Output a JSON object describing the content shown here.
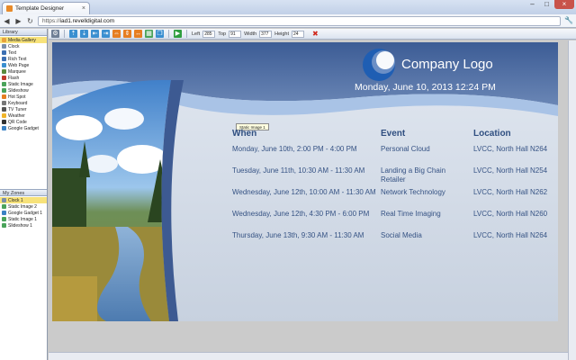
{
  "browser": {
    "tab_title": "Template Designer",
    "tab_close": "×",
    "address_scheme": "https://",
    "address_rest": "iad1.revelldigital.com",
    "window_controls": [
      "–",
      "□",
      "×"
    ],
    "nav_back": "◀",
    "nav_forward": "▶",
    "nav_reload": "↻",
    "wrench": "🔧"
  },
  "sidebar": {
    "library_header": "Library",
    "library_items": [
      {
        "label": "Media Gallery",
        "color": "#e8a23b",
        "selected": true
      },
      {
        "label": "Clock",
        "color": "#7b8fa8"
      },
      {
        "label": "Text",
        "color": "#3c6fb3"
      },
      {
        "label": "Rich Text",
        "color": "#3c6fb3"
      },
      {
        "label": "Web Page",
        "color": "#3a8fd0"
      },
      {
        "label": "Marquee",
        "color": "#5a8a3c"
      },
      {
        "label": "Flash",
        "color": "#c0392b"
      },
      {
        "label": "Static Image",
        "color": "#4aa35a"
      },
      {
        "label": "Slideshow",
        "color": "#4aa35a"
      },
      {
        "label": "Hot Spot",
        "color": "#e67e22"
      },
      {
        "label": "Keyboard",
        "color": "#777777"
      },
      {
        "label": "TV Tuner",
        "color": "#555555"
      },
      {
        "label": "Weather",
        "color": "#f0b429"
      },
      {
        "label": "QR Code",
        "color": "#333333"
      },
      {
        "label": "Google Gadget",
        "color": "#3b82c4"
      }
    ],
    "zones_header": "My Zones",
    "zone_items": [
      {
        "label": "Clock 1",
        "color": "#7b8fa8",
        "selected": true
      },
      {
        "label": "Static Image 2",
        "color": "#4aa35a"
      },
      {
        "label": "Google Gadget 1",
        "color": "#3b82c4"
      },
      {
        "label": "Static Image 1",
        "color": "#4aa35a"
      },
      {
        "label": "Slideshow 1",
        "color": "#4aa35a"
      }
    ]
  },
  "toolbar": {
    "buttons": [
      {
        "name": "settings-button",
        "icon": "⚙",
        "color": "#6f7f96"
      },
      {
        "name": "bring-front-button",
        "icon": "⇡",
        "color": "#3a8fd0"
      },
      {
        "name": "send-back-button",
        "icon": "⇣",
        "color": "#3a8fd0"
      },
      {
        "name": "align-left-button",
        "icon": "⇤",
        "color": "#3a8fd0"
      },
      {
        "name": "align-right-button",
        "icon": "⇥",
        "color": "#3a8fd0"
      },
      {
        "name": "center-h-button",
        "icon": "⇔",
        "color": "#e67e22"
      },
      {
        "name": "center-v-button",
        "icon": "⇕",
        "color": "#e67e22"
      },
      {
        "name": "fit-width-button",
        "icon": "↔",
        "color": "#e67e22"
      },
      {
        "name": "grid-button",
        "icon": "▦",
        "color": "#4aa35a"
      },
      {
        "name": "copy-button",
        "icon": "❐",
        "color": "#3a8fd0"
      },
      {
        "name": "preview-button",
        "icon": "▶",
        "color": "#2e9e3e"
      }
    ],
    "fields": [
      {
        "label": "Left",
        "value": "285"
      },
      {
        "label": "Top",
        "value": "91"
      },
      {
        "label": "Width",
        "value": "377"
      },
      {
        "label": "Height",
        "value": "24"
      }
    ],
    "delete_icon": "✖"
  },
  "template": {
    "company_logo": "Company Logo",
    "datetime": "Monday, June 10, 2013  12:24 PM",
    "tooltip": "Static Image 1",
    "schedule": {
      "headers": {
        "when": "When",
        "event": "Event",
        "location": "Location"
      },
      "rows": [
        {
          "when": "Monday, June 10th, 2:00 PM - 4:00 PM",
          "event": "Personal Cloud",
          "location": "LVCC, North Hall N264"
        },
        {
          "when": "Tuesday, June 11th, 10:30 AM - 11:30 AM",
          "event": "Landing a Big Chain Retailer",
          "location": "LVCC, North Hall N254"
        },
        {
          "when": "Wednesday, June 12th, 10:00 AM - 11:30 AM",
          "event": "Network Technology",
          "location": "LVCC, North Hall N262"
        },
        {
          "when": "Wednesday, June 12th, 4:30 PM - 6:00 PM",
          "event": "Real Time Imaging",
          "location": "LVCC, North Hall N260"
        },
        {
          "when": "Thursday, June 13th, 9:30 AM - 11:30 AM",
          "event": "Social Media",
          "location": "LVCC, North Hall N264"
        }
      ]
    }
  }
}
